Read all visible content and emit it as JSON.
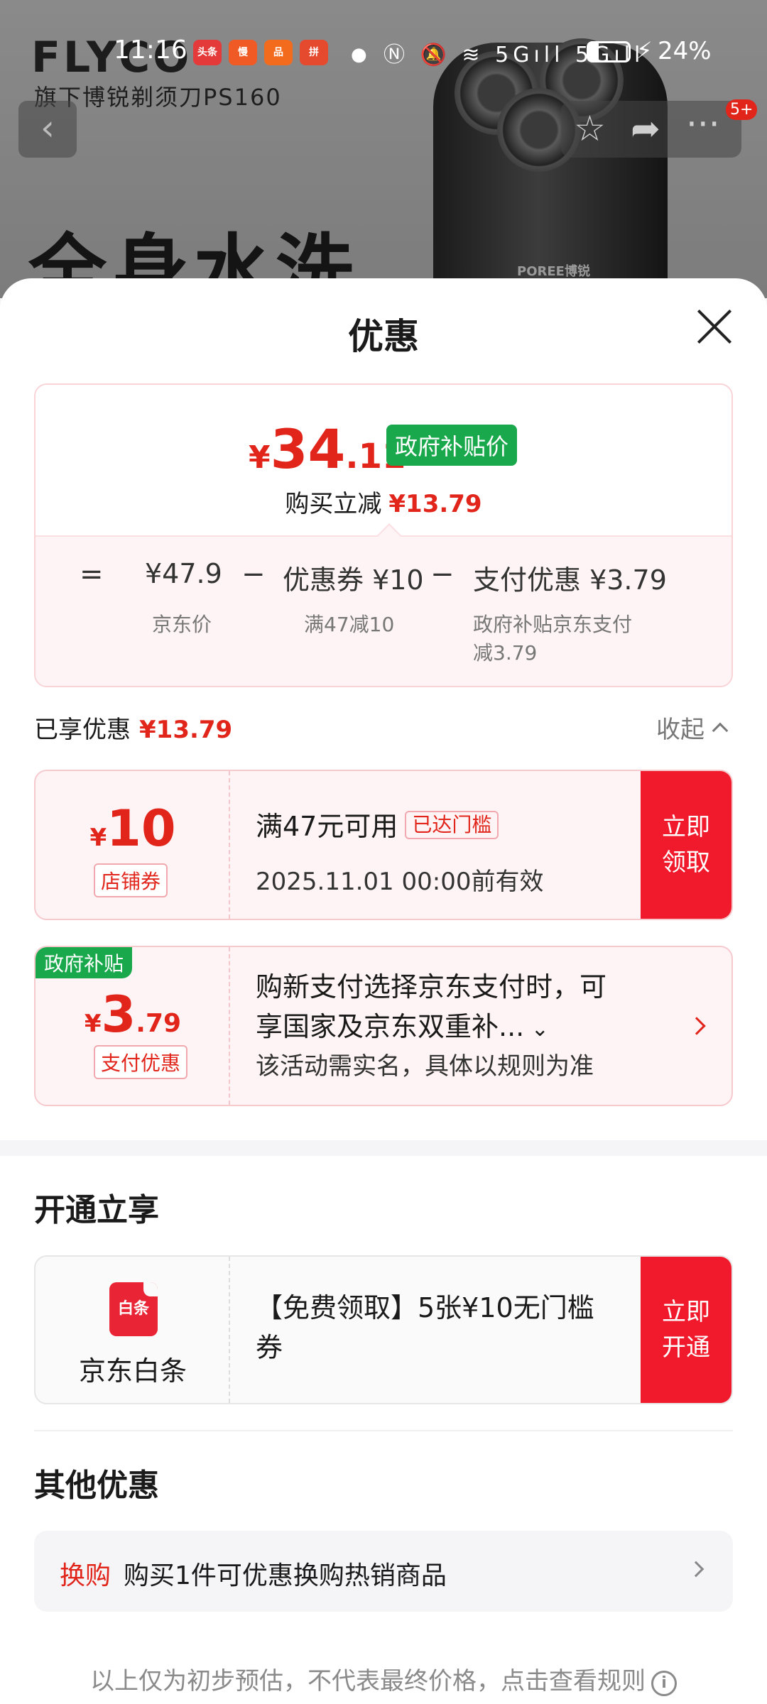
{
  "status_bar": {
    "time": "11:16",
    "app_icons": [
      "头条",
      "慢",
      "品",
      "拼"
    ],
    "battery_pct": "24%",
    "signal_label": "5G"
  },
  "backdrop": {
    "brand": "FLYCO",
    "subtitle": "旗下博锐剃须刀PS160",
    "headline": "全身水洗",
    "product_mark": "POREE博锐",
    "message_badge": "5+"
  },
  "sheet": {
    "title": "优惠",
    "price": {
      "yen": "¥",
      "integer": "34",
      "decimal": ".11",
      "tag": "政府补贴价",
      "reduce_label": "购买立减",
      "reduce_value": "¥13.79"
    },
    "breakdown": {
      "eq": "=",
      "jd_price": "¥47.9",
      "minus1": "−",
      "coupon": "优惠券 ¥10",
      "minus2": "−",
      "pay": "支付优惠 ¥3.79",
      "jd_caption": "京东价",
      "coupon_caption": "满47减10",
      "pay_caption_1": "政府补贴京东支付",
      "pay_caption_2": "减3.79"
    },
    "enjoyed": {
      "label": "已享优惠",
      "value": "¥13.79",
      "collapse": "收起"
    },
    "coupon1": {
      "yen": "¥",
      "amount": "10",
      "kind": "店铺券",
      "title": "满47元可用",
      "reached": "已达门槛",
      "expiry": "2025.11.01 00:00前有效",
      "cta_1": "立即",
      "cta_2": "领取"
    },
    "coupon2": {
      "gov_tag": "政府补贴",
      "yen": "¥",
      "amount": "3",
      "decimal": ".79",
      "kind": "支付优惠",
      "line1": "购新支付选择京东支付时，可",
      "line2": "享国家及京东双重补...",
      "note": "该活动需实名，具体以规则为准"
    },
    "open_section": {
      "title": "开通立享",
      "logo_text": "白条",
      "name": "京东白条",
      "text_1": "【免费领取】5张¥10无门槛",
      "text_2": "券",
      "cta_1": "立即",
      "cta_2": "开通"
    },
    "other_section": {
      "title": "其他优惠",
      "swap_tag": "换购",
      "swap_text": "购买1件可优惠换购热销商品"
    },
    "footnote": "以上仅为初步预估，不代表最终价格，点击查看规则"
  },
  "colors": {
    "accent_red": "#e1251b",
    "cta_red": "#f1192c",
    "gov_green": "#19a84b",
    "card_pink": "#fef4f5"
  }
}
